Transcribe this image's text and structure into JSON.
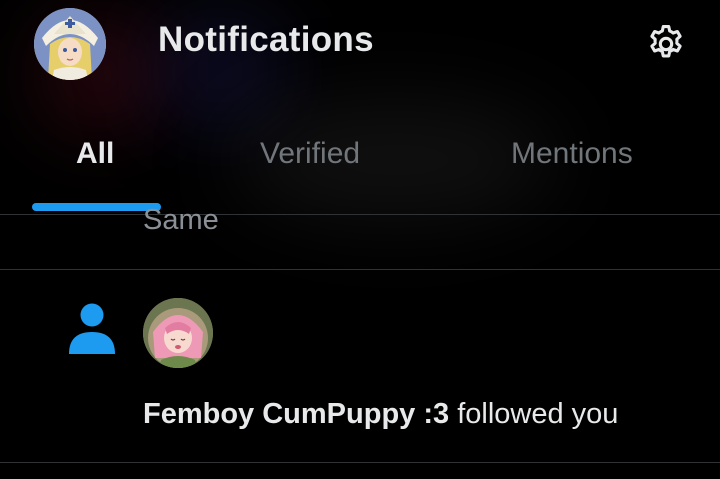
{
  "header": {
    "title": "Notifications",
    "settings_icon": "gear-icon"
  },
  "tabs": [
    {
      "label": "All",
      "active": true
    },
    {
      "label": "Verified",
      "active": false
    },
    {
      "label": "Mentions",
      "active": false
    }
  ],
  "notifications": {
    "previous_item_text": "Same",
    "follow_item": {
      "icon": "person-icon",
      "name": "Femboy CumPuppy :3",
      "action": "followed you"
    }
  },
  "colors": {
    "accent": "#1d9bf0",
    "text_primary": "#e7e9ea",
    "text_secondary": "#71767b",
    "divider": "#2f3336",
    "background": "#000000"
  }
}
